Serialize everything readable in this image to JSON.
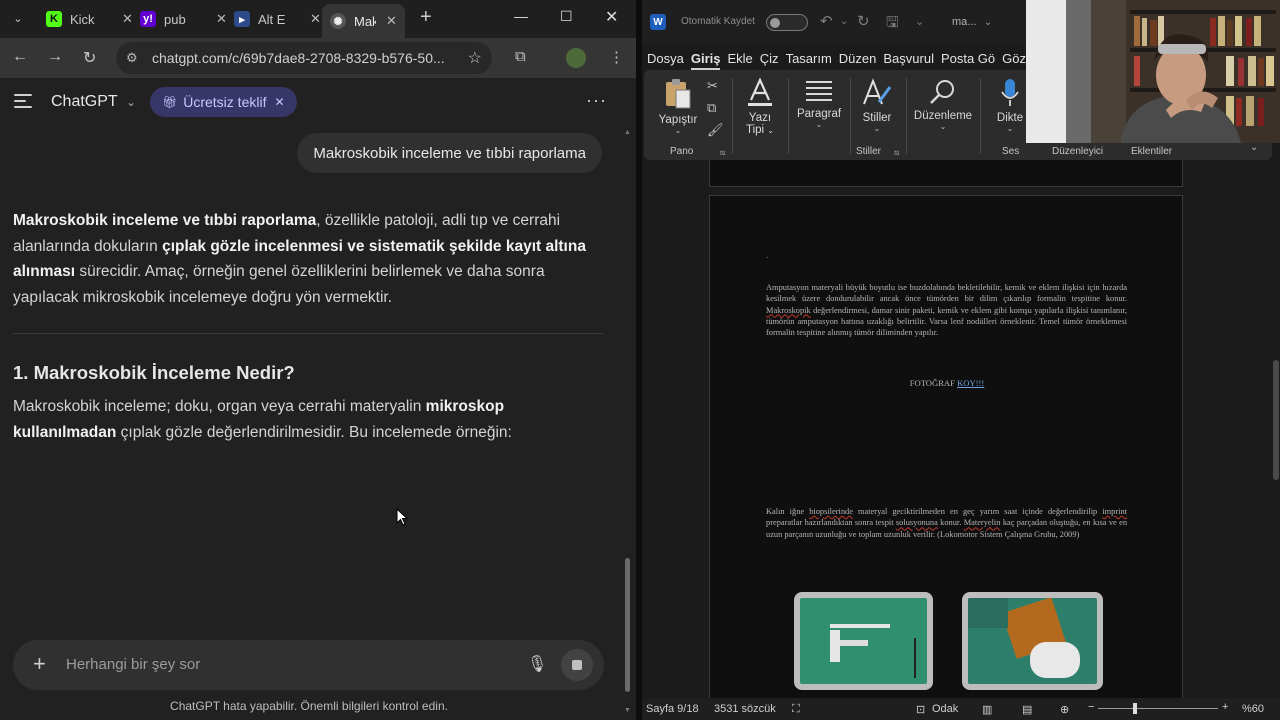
{
  "browser": {
    "tabs": [
      {
        "label": "Kick",
        "favicon": "kick-icon",
        "color": "#53fc18"
      },
      {
        "label": "pub",
        "favicon": "yahoo-icon",
        "color": "#6001d2"
      },
      {
        "label": "Alt E",
        "favicon": "app-icon",
        "color": "#2d4a8a"
      },
      {
        "label": "Mak",
        "favicon": "chatgpt-icon",
        "color": "#cccccc"
      }
    ],
    "url": "chatgpt.com/c/69b7dae8-2708-8329-b576-50..."
  },
  "chat": {
    "app_title": "ChatGPT",
    "offer_label": "Ücretsiz teklif",
    "user_message": "Makroskobik inceleme ve tıbbi raporlama",
    "answer": {
      "p1_b1": "Makroskobik inceleme ve tıbbi raporlama",
      "p1_t1": ", özellikle patoloji, adli tıp ve cerrahi alanlarında dokuların ",
      "p1_b2": "çıplak gözle incelenmesi ve sistematik şekilde kayıt altına alınması",
      "p1_t2": " sürecidir. Amaç, örneğin genel özelliklerini belirlemek ve daha sonra yapılacak mikroskobik incelemeye doğru yön vermektir.",
      "heading": "1. Makroskobik İnceleme Nedir?",
      "p2_t1": "Makroskobik inceleme; doku, organ veya cerrahi materyalin ",
      "p2_b1": "mikroskop kullanılmadan",
      "p2_t2": " çıplak gözle değerlendirilmesidir. Bu incelemede örneğin:"
    },
    "composer_placeholder": "Herhangi bir şey sor",
    "disclaimer": "ChatGPT hata yapabilir. Önemli bilgileri kontrol edin."
  },
  "word": {
    "autosave_label": "Otomatik Kaydet",
    "doc_name": "ma...",
    "menu_tabs": [
      "Dosya",
      "Giriş",
      "Ekle",
      "Çiz",
      "Tasarım",
      "Düzen",
      "Başvurul",
      "Posta Gö",
      "Göz"
    ],
    "active_tab": "Giriş",
    "ribbon": {
      "paste": "Yapıştır",
      "font_l1": "Yazı",
      "font_l2": "Tipi",
      "paragraph": "Paragraf",
      "styles": "Stiller",
      "editing": "Düzenleme",
      "dictate": "Dikte",
      "group_clipboard": "Pano",
      "group_styles": "Stiller",
      "group_voice": "Ses",
      "group_editor": "Düzenleyici",
      "group_addins": "Eklentiler"
    },
    "document": {
      "dot": ".",
      "para1_a": "Amputasyon materyali büyük boyutlu ise buzdolabında bekletilebilir, kemik ve eklem ilişkisi için hızarda kesilmek üzere dondurulabilir ancak önce tümörden bir dilim çıkarılıp formalin tespitine konur. ",
      "para1_sq": "Makroskopik",
      "para1_b": " değerlendirmesi, damar sinir paketi, kemik ve eklem gibi komşu yapılarla ilişkisi tanımlanır, tümörün amputasyon hattına uzaklığı belirtilir. Varsa lenf nodülleri örneklenir. Temel tümör örneklemesi formalin tespitine alınmış tümör diliminden yapılır.",
      "foto_a": "FOTOĞRAF ",
      "foto_b": "KOY!!!",
      "para2_a": "Kalın iğne ",
      "para2_sq1": "biopsilerinde",
      "para2_b": " materyal geciktirilmeden en geç yarım saat içinde değerlendirilip ",
      "para2_sq2": "imprint",
      "para2_c": " preparatlar hazırlandıktan sonra tespit ",
      "para2_sq3": "solusyonuna",
      "para2_d": " konur. ",
      "para2_sq4": "Materyelin",
      "para2_e": " kaç parçadan oluştuğu, en kısa ve en uzun parçanın uzunluğu ve toplam uzunluk verilir. (Lokomotor Sistem Çalışma Grubu, 2009)"
    },
    "status": {
      "page": "Sayfa 9/18",
      "words": "3531 sözcük",
      "focus": "Odak",
      "zoom": "%60"
    }
  }
}
